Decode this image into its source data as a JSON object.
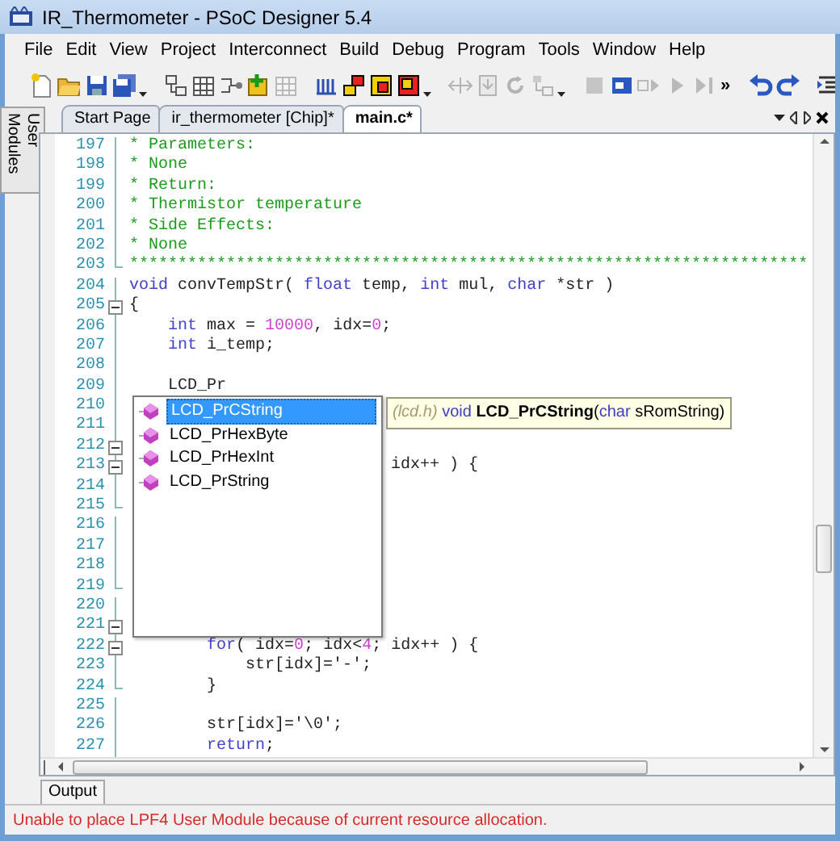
{
  "window": {
    "title": "IR_Thermometer - PSoC Designer 5.4"
  },
  "menu": [
    "File",
    "Edit",
    "View",
    "Project",
    "Interconnect",
    "Build",
    "Debug",
    "Program",
    "Tools",
    "Window",
    "Help"
  ],
  "toolbar": [
    {
      "buttons": [
        {
          "disabled": false
        },
        {
          "disabled": false
        },
        {
          "disabled": false
        },
        {
          "disabled": false
        }
      ],
      "dropdown": true
    },
    {
      "buttons": [
        {
          "disabled": false
        },
        {
          "disabled": false
        },
        {
          "disabled": false
        },
        {
          "disabled": false
        },
        {
          "disabled": true
        }
      ]
    },
    {
      "buttons": [
        {
          "disabled": false
        },
        {
          "disabled": false
        },
        {
          "disabled": false
        },
        {
          "disabled": false
        }
      ],
      "dropdown": true
    },
    {
      "buttons": [
        {
          "disabled": true
        },
        {
          "disabled": true
        },
        {
          "disabled": true
        },
        {
          "disabled": true
        }
      ],
      "dropdown": true
    },
    {
      "buttons": [
        {
          "disabled": true
        },
        {
          "disabled": false
        },
        {
          "disabled": true
        },
        {
          "disabled": true
        },
        {
          "disabled": true
        }
      ],
      "overflow": "»"
    },
    {
      "buttons": [
        {
          "disabled": false
        },
        {
          "disabled": false
        }
      ]
    },
    {
      "buttons": [
        {
          "disabled": false
        }
      ]
    }
  ],
  "side_panel": {
    "tab": "User Modules"
  },
  "tabs": [
    {
      "label": "Start Page",
      "selected": false
    },
    {
      "label": "ir_thermometer [Chip]*",
      "selected": false
    },
    {
      "label": "main.c*",
      "selected": true
    }
  ],
  "editor": {
    "lines": [
      {
        "number": "197",
        "fold_start": false,
        "fold_end": false,
        "code": [
          {
            "kind": "comment",
            "text": "* Parameters:"
          }
        ]
      },
      {
        "number": "198",
        "fold_start": false,
        "fold_end": false,
        "code": [
          {
            "kind": "comment",
            "text": "* None"
          }
        ]
      },
      {
        "number": "199",
        "fold_start": false,
        "fold_end": false,
        "code": [
          {
            "kind": "comment",
            "text": "* Return:"
          }
        ]
      },
      {
        "number": "200",
        "fold_start": false,
        "fold_end": false,
        "code": [
          {
            "kind": "comment",
            "text": "* Thermistor temperature"
          }
        ]
      },
      {
        "number": "201",
        "fold_start": false,
        "fold_end": false,
        "code": [
          {
            "kind": "comment",
            "text": "* Side Effects:"
          }
        ]
      },
      {
        "number": "202",
        "fold_start": false,
        "fold_end": false,
        "code": [
          {
            "kind": "comment",
            "text": "* None"
          }
        ]
      },
      {
        "number": "203",
        "fold_start": false,
        "fold_end": true,
        "code": [
          {
            "kind": "comment",
            "text": "**********************************************************************"
          }
        ]
      },
      {
        "number": "204",
        "fold_start": false,
        "fold_end": false,
        "code": [
          {
            "kind": "keyword",
            "text": "void"
          },
          {
            "kind": "plain",
            "text": " convTempStr( "
          },
          {
            "kind": "keyword",
            "text": "float"
          },
          {
            "kind": "plain",
            "text": " temp, "
          },
          {
            "kind": "keyword",
            "text": "int"
          },
          {
            "kind": "plain",
            "text": " mul, "
          },
          {
            "kind": "keyword",
            "text": "char"
          },
          {
            "kind": "plain",
            "text": " *str )"
          }
        ]
      },
      {
        "number": "205",
        "fold_start": true,
        "fold_end": false,
        "code": [
          {
            "kind": "plain",
            "text": "{"
          }
        ]
      },
      {
        "number": "206",
        "fold_start": false,
        "fold_end": false,
        "code": [
          {
            "kind": "keyword",
            "text": "    int"
          },
          {
            "kind": "plain",
            "text": " max = "
          },
          {
            "kind": "number",
            "text": "10000"
          },
          {
            "kind": "plain",
            "text": ", idx="
          },
          {
            "kind": "number",
            "text": "0"
          },
          {
            "kind": "plain",
            "text": ";"
          }
        ]
      },
      {
        "number": "207",
        "fold_start": false,
        "fold_end": false,
        "code": [
          {
            "kind": "keyword",
            "text": "    int"
          },
          {
            "kind": "plain",
            "text": " i_temp;"
          }
        ]
      },
      {
        "number": "208",
        "fold_start": false,
        "fold_end": false
      },
      {
        "number": "209",
        "fold_start": false,
        "fold_end": false,
        "code": [
          {
            "kind": "plain",
            "text": "    LCD_Pr"
          }
        ]
      },
      {
        "number": "210",
        "fold_start": false,
        "fold_end": false
      },
      {
        "number": "211",
        "fold_start": false,
        "fold_end": false
      },
      {
        "number": "212",
        "fold_start": true,
        "fold_end": false
      },
      {
        "number": "213",
        "fold_start": true,
        "fold_end": false,
        "code": [
          {
            "kind": "plain",
            "text": "                           idx++ ) {"
          }
        ]
      },
      {
        "number": "214",
        "fold_start": false,
        "fold_end": false
      },
      {
        "number": "215",
        "fold_start": false,
        "fold_end": true
      },
      {
        "number": "216",
        "fold_start": false,
        "fold_end": false
      },
      {
        "number": "217",
        "fold_start": false,
        "fold_end": false
      },
      {
        "number": "218",
        "fold_start": false,
        "fold_end": false
      },
      {
        "number": "219",
        "fold_start": false,
        "fold_end": true
      },
      {
        "number": "220",
        "fold_start": false,
        "fold_end": false
      },
      {
        "number": "221",
        "fold_start": true,
        "fold_end": false
      },
      {
        "number": "222",
        "fold_start": true,
        "fold_end": false,
        "code": [
          {
            "kind": "keyword",
            "text": "        for"
          },
          {
            "kind": "plain",
            "text": "( idx="
          },
          {
            "kind": "number",
            "text": "0"
          },
          {
            "kind": "plain",
            "text": "; idx<"
          },
          {
            "kind": "number",
            "text": "4"
          },
          {
            "kind": "plain",
            "text": "; idx++ ) {"
          }
        ]
      },
      {
        "number": "223",
        "fold_start": false,
        "fold_end": false,
        "code": [
          {
            "kind": "plain",
            "text": "            str[idx]='-';"
          }
        ]
      },
      {
        "number": "224",
        "fold_start": false,
        "fold_end": true,
        "code": [
          {
            "kind": "plain",
            "text": "        }"
          }
        ]
      },
      {
        "number": "225",
        "fold_start": false,
        "fold_end": false
      },
      {
        "number": "226",
        "fold_start": false,
        "fold_end": false,
        "code": [
          {
            "kind": "plain",
            "text": "        str[idx]='\\0';"
          }
        ]
      },
      {
        "number": "227",
        "fold_start": false,
        "fold_end": false,
        "code": [
          {
            "kind": "keyword",
            "text": "        return"
          },
          {
            "kind": "plain",
            "text": ";"
          }
        ]
      }
    ],
    "autocomplete": {
      "items": [
        {
          "label": "LCD_PrCString",
          "selected": true
        },
        {
          "label": "LCD_PrHexByte",
          "selected": false
        },
        {
          "label": "LCD_PrHexInt",
          "selected": false
        },
        {
          "label": "LCD_PrString",
          "selected": false
        }
      ],
      "tooltip": [
        {
          "kind": "header",
          "text": "(lcd.h)"
        },
        {
          "kind": "keyword",
          "text": " void "
        },
        {
          "kind": "bold",
          "text": "LCD_PrCString"
        },
        {
          "kind": "plain",
          "text": "("
        },
        {
          "kind": "keyword",
          "text": "char"
        },
        {
          "kind": "plain",
          "text": " sRomString)"
        }
      ]
    }
  },
  "output": {
    "tab": "Output",
    "message": {
      "kind": "error",
      "text": "Unable to place LPF4 User Module because of current resource allocation."
    }
  }
}
